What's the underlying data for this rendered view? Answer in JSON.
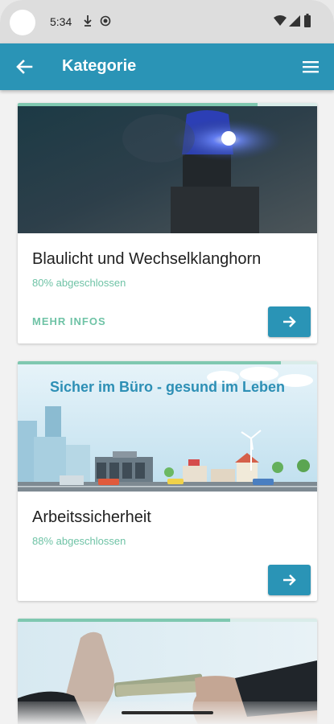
{
  "status_bar": {
    "time": "5:34"
  },
  "app_bar": {
    "title": "Kategorie",
    "back_icon": "arrow-left-icon",
    "menu_icon": "hamburger-menu-icon"
  },
  "colors": {
    "primary": "#2a94b6",
    "accent": "#6fc3a6"
  },
  "cards": [
    {
      "title": "Blaulicht und Wechselklanghorn",
      "progress_text": "80% abgeschlossen",
      "progress": 0.8,
      "more_info_label": "MEHR INFOS",
      "image": "blue-police-light-image"
    },
    {
      "title": "Arbeitssicherheit",
      "progress_text": "88% abgeschlossen",
      "progress": 0.88,
      "banner_text": "Sicher im Büro - gesund im Leben",
      "image": "office-city-illustration-image"
    },
    {
      "progress": 0.71,
      "image": "bribery-hands-image"
    }
  ]
}
